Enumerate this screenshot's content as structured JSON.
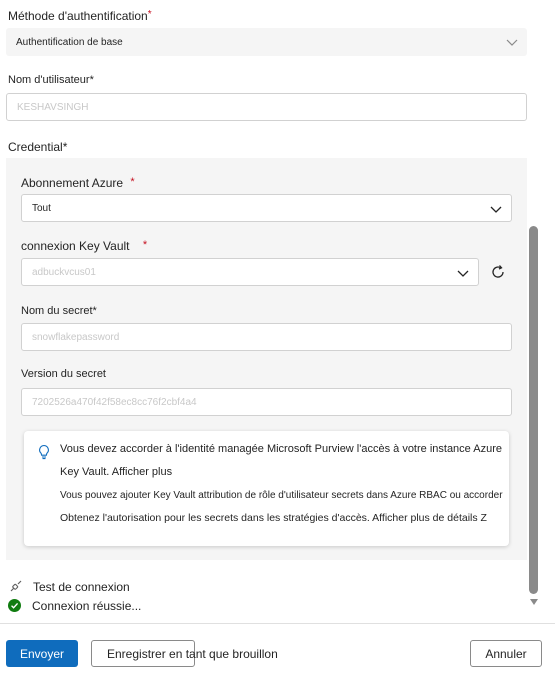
{
  "auth": {
    "label": "Méthode d'authentification",
    "required_mark": "*",
    "value": "Authentification de base"
  },
  "username": {
    "label": "Nom d'utilisateur",
    "required_mark": "*",
    "placeholder": "KESHAVSINGH"
  },
  "credential": {
    "label": "Credential",
    "required_mark": "*",
    "subscription": {
      "label": "Abonnement Azure",
      "required_mark": "*",
      "value": "Tout"
    },
    "keyvault": {
      "label": "connexion Key Vault",
      "required_mark": "*",
      "placeholder": "adbuckvcus01"
    },
    "secret_name": {
      "label": "Nom du secret",
      "required_mark": "*",
      "placeholder": "snowflakepassword"
    },
    "secret_version": {
      "label": "Version du secret",
      "placeholder": "7202526a470f42f58ec8cc76f2cbf4a4"
    },
    "info": {
      "line1": "Vous devez accorder à l'identité managée Microsoft Purview l'accès à votre instance Azure",
      "line2": "Key Vault. Afficher plus",
      "line3": "Vous pouvez ajouter Key Vault attribution de rôle d'utilisateur secrets dans Azure RBAC ou accorder",
      "line4": "Obtenez l'autorisation pour les secrets dans les stratégies d'accès. Afficher plus de détails Z"
    }
  },
  "test": {
    "label": "Test de connexion",
    "status": "Connexion réussie..."
  },
  "footer": {
    "submit": "Envoyer",
    "save_draft": "Enregistrer en tant que brouillon",
    "cancel": "Annuler"
  },
  "colors": {
    "primary": "#0f6cbd",
    "success": "#107c10",
    "required": "#c50f1f"
  }
}
